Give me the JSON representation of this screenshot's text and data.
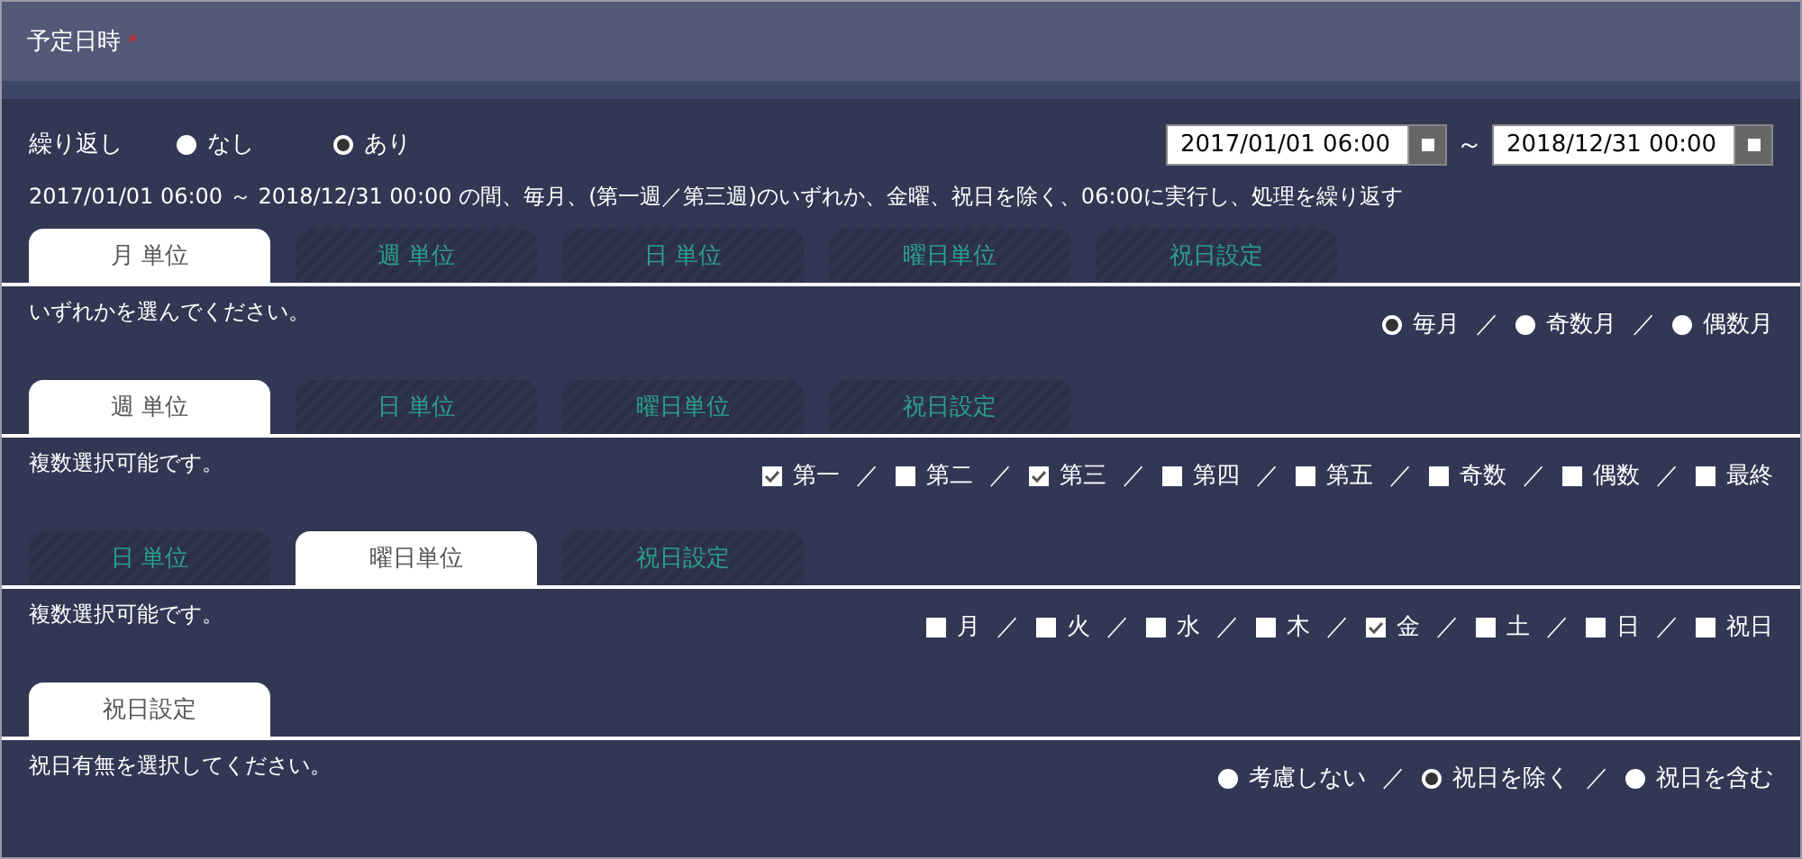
{
  "header": {
    "title": "予定日時",
    "required_mark": "*"
  },
  "repeat": {
    "label": "繰り返し",
    "options": [
      {
        "label": "なし",
        "selected": false
      },
      {
        "label": "あり",
        "selected": true
      }
    ]
  },
  "date_range": {
    "start": "2017/01/01 06:00",
    "separator": "～",
    "end": "2018/12/31 00:00"
  },
  "summary": "2017/01/01 06:00 ～ 2018/12/31 00:00 の間、毎月、(第一週／第三週)のいずれか、金曜、祝日を除く、06:00に実行し、処理を繰り返す",
  "sections": [
    {
      "tabs": [
        {
          "label": "月 単位",
          "selected": true
        },
        {
          "label": "週 単位",
          "selected": false
        },
        {
          "label": "日 単位",
          "selected": false
        },
        {
          "label": "曜日単位",
          "selected": false
        },
        {
          "label": "祝日設定",
          "selected": false
        }
      ],
      "hint": "いずれかを選んでください。",
      "kind": "radio",
      "options": [
        {
          "label": "毎月",
          "selected": true
        },
        {
          "separator": "／",
          "label": "奇数月",
          "selected": false
        },
        {
          "separator": "／",
          "label": "偶数月",
          "selected": false
        }
      ]
    },
    {
      "tabs": [
        {
          "label": "週 単位",
          "selected": true
        },
        {
          "label": "日 単位",
          "selected": false
        },
        {
          "label": "曜日単位",
          "selected": false
        },
        {
          "label": "祝日設定",
          "selected": false
        }
      ],
      "hint": "複数選択可能です。",
      "kind": "checkbox",
      "options": [
        {
          "label": "第一",
          "checked": true
        },
        {
          "separator": "／",
          "label": "第二",
          "checked": false
        },
        {
          "separator": "／",
          "label": "第三",
          "checked": true
        },
        {
          "separator": "／",
          "label": "第四",
          "checked": false
        },
        {
          "separator": "／",
          "label": "第五",
          "checked": false
        },
        {
          "separator": "／",
          "label": "奇数",
          "checked": false
        },
        {
          "separator": "／",
          "label": "偶数",
          "checked": false
        },
        {
          "separator": "／",
          "label": "最終",
          "checked": false
        }
      ]
    },
    {
      "tabs": [
        {
          "label": "日 単位",
          "selected": false
        },
        {
          "label": "曜日単位",
          "selected": true
        },
        {
          "label": "祝日設定",
          "selected": false
        }
      ],
      "hint": "複数選択可能です。",
      "kind": "checkbox",
      "options": [
        {
          "label": "月",
          "checked": false
        },
        {
          "separator": "／",
          "label": "火",
          "checked": false
        },
        {
          "separator": "／",
          "label": "水",
          "checked": false
        },
        {
          "separator": "／",
          "label": "木",
          "checked": false
        },
        {
          "separator": "／",
          "label": "金",
          "checked": true
        },
        {
          "separator": "／",
          "label": "土",
          "checked": false
        },
        {
          "separator": "／",
          "label": "日",
          "checked": false
        },
        {
          "separator": "／",
          "label": "祝日",
          "checked": false
        }
      ]
    },
    {
      "tabs": [
        {
          "label": "祝日設定",
          "selected": true
        }
      ],
      "hint": "祝日有無を選択してください。",
      "kind": "radio",
      "options": [
        {
          "label": "考慮しない",
          "selected": false
        },
        {
          "separator": "／",
          "label": "祝日を除く",
          "selected": true
        },
        {
          "separator": "／",
          "label": "祝日を含む",
          "selected": false
        }
      ]
    }
  ]
}
